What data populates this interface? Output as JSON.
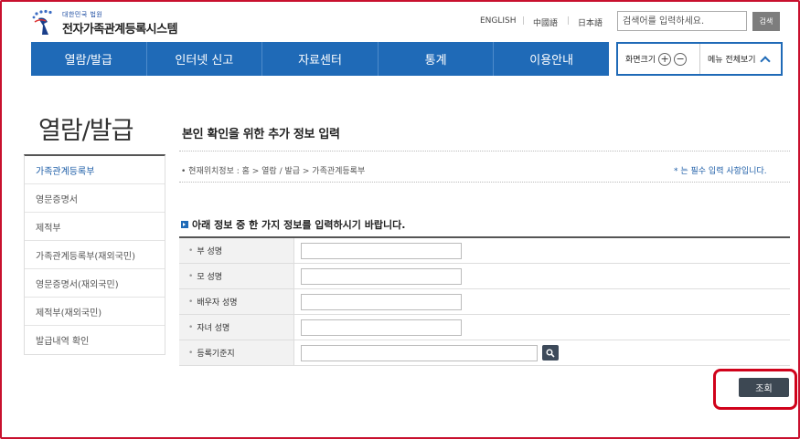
{
  "header": {
    "logo_sub": "대한민국 법원",
    "logo_main": "전자가족관계등록시스템",
    "languages": [
      "ENGLISH",
      "中國語",
      "日本語"
    ],
    "search_placeholder": "검색어를 입력하세요.",
    "search_button": "검색"
  },
  "nav": {
    "items": [
      "열람/발급",
      "인터넷 신고",
      "자료센터",
      "통계",
      "이용안내"
    ]
  },
  "tools": {
    "font_size_label": "화면크기",
    "zoom_in": "+",
    "zoom_out": "−",
    "menu_all_label": "메뉴 전체보기"
  },
  "sidebar": {
    "title": "열람/발급",
    "items": [
      "가족관계등록부",
      "영문증명서",
      "제적부",
      "가족관계등록부(재외국민)",
      "영문증명서(재외국민)",
      "제적부(재외국민)",
      "발급내역 확인"
    ],
    "active_index": 0
  },
  "main": {
    "title": "본인 확인을 위한 추가 정보 입력",
    "breadcrumb": "• 현재위치정보 : 홈 > 열람 / 발급 > 가족관계등록부",
    "required_note": "* 는 필수 입력 사항입니다.",
    "section_heading": "아래 정보 중 한 가지 정보를 입력하시기 바랍니다.",
    "fields": [
      {
        "label": "부 성명",
        "value": ""
      },
      {
        "label": "모 성명",
        "value": ""
      },
      {
        "label": "배우자 성명",
        "value": ""
      },
      {
        "label": "자녀 성명",
        "value": ""
      },
      {
        "label": "등록기준지",
        "value": ""
      }
    ],
    "submit_label": "조회"
  },
  "colors": {
    "nav_blue": "#1f6ab7",
    "highlight_red": "#d0021b",
    "button_dark": "#3d4853"
  }
}
